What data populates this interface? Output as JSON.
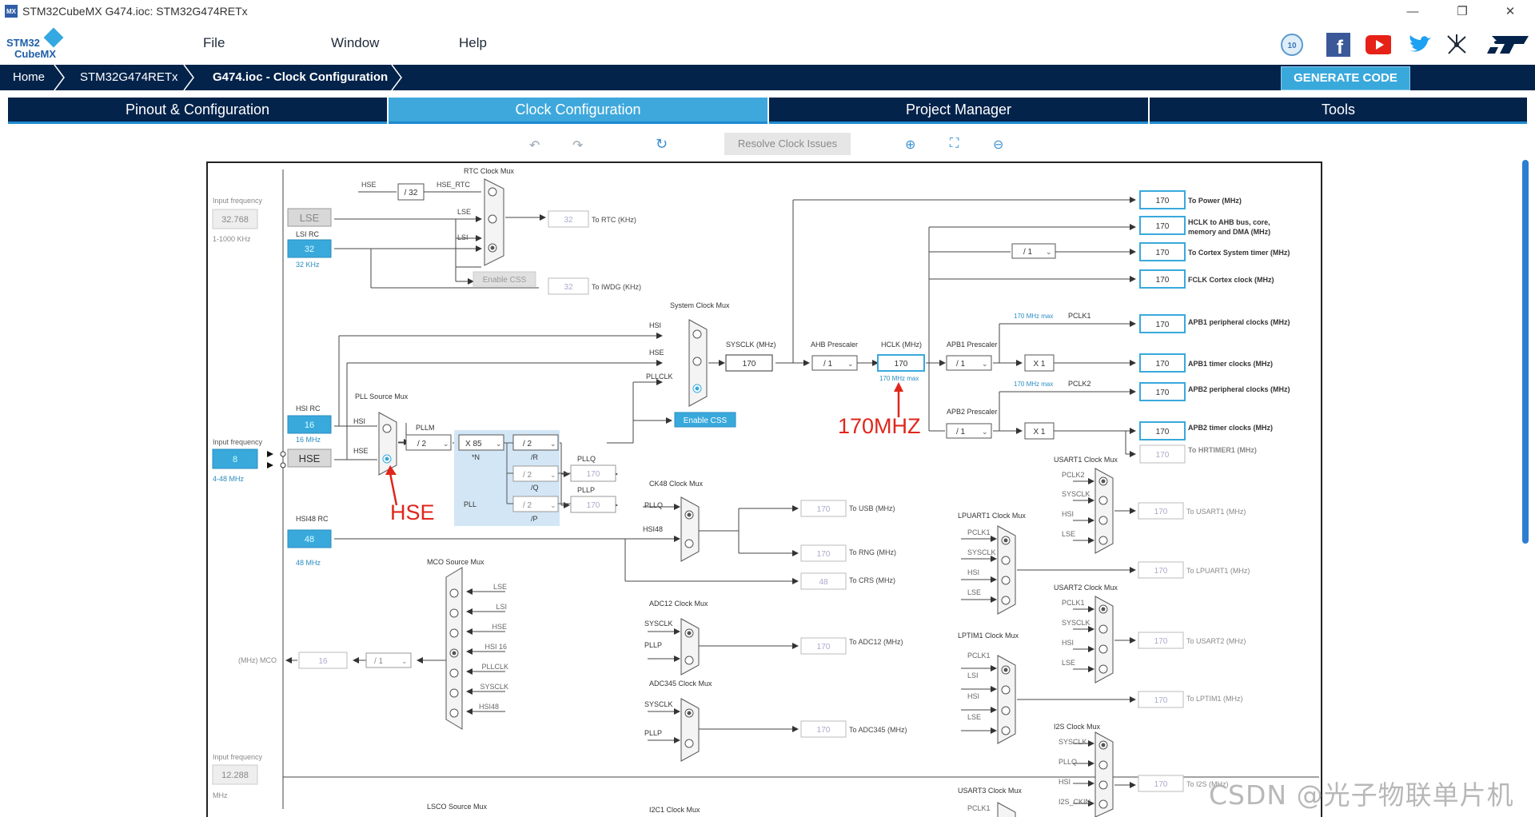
{
  "window": {
    "title": "STM32CubeMX G474.ioc: STM32G474RETx",
    "minimize": "—",
    "restore": "❐",
    "close": "✕"
  },
  "app": {
    "logo_line1": "STM32",
    "logo_line2": "CubeMX",
    "icon_text": "MX"
  },
  "menu": {
    "items": [
      "File",
      "Window",
      "Help"
    ]
  },
  "breadcrumb": [
    "Home",
    "STM32G474RETx",
    "G474.ioc - Clock Configuration"
  ],
  "generate_code_label": "GENERATE CODE",
  "tabs": [
    "Pinout & Configuration",
    "Clock Configuration",
    "Project Manager",
    "Tools"
  ],
  "active_tab": "Clock Configuration",
  "toolbar": {
    "resolve_label": "Resolve Clock Issues"
  },
  "colors": {
    "accent": "#3ea8dc",
    "navy": "#03234b",
    "red": "#e0261b"
  },
  "watermark": "CSDN @光子物联单片机",
  "diagram": {
    "inputs": {
      "lse_input_label": "Input frequency",
      "lse_input_value": "32.768",
      "lse_input_range": "1-1000 KHz",
      "hse_input_label": "Input frequency",
      "hse_input_value": "8",
      "hse_input_range": "4-48 MHz",
      "i2s_input_label": "Input frequency",
      "i2s_input_value": "12.288",
      "i2s_input_unit": "MHz"
    },
    "sources": {
      "lse": "LSE",
      "lsi_rc": "LSI RC",
      "lsi_value": "32",
      "lsi_unit": "32 KHz",
      "hsi_rc": "HSI RC",
      "hsi_value": "16",
      "hsi_unit": "16 MHz",
      "hse": "HSE",
      "hsi48_rc": "HSI48 RC",
      "hsi48_value": "48",
      "hsi48_unit": "48 MHz"
    },
    "rtc": {
      "title": "RTC Clock Mux",
      "hse": "HSE",
      "div": "/ 32",
      "hse_rtc": "HSE_RTC",
      "lse": "LSE",
      "lsi": "LSI",
      "enable_css": "Enable CSS",
      "rtc_value": "32",
      "rtc_label": "To RTC (KHz)",
      "iwdg_value": "32",
      "iwdg_label": "To IWDG (KHz)"
    },
    "pll": {
      "source_mux": "PLL Source Mux",
      "hsi": "HSI",
      "hse": "HSE",
      "pllm_label": "PLLM",
      "pllm": "/ 2",
      "muln": "X 85",
      "n": "*N",
      "divr": "/ 2",
      "r": "/R",
      "divq": "/ 2",
      "q": "/Q",
      "divp": "/ 2",
      "p": "/P",
      "pll": "PLL",
      "pllq": "PLLQ",
      "pllq_value": "170",
      "pllp": "PLLP",
      "pllp_value": "170"
    },
    "sysmux": {
      "title": "System Clock Mux",
      "hsi": "HSI",
      "hse": "HSE",
      "pllclk": "PLLCLK",
      "enable_css": "Enable CSS",
      "sysclk_label": "SYSCLK (MHz)",
      "sysclk": "170"
    },
    "ahb": {
      "label": "AHB Prescaler",
      "value": "/ 1",
      "hclk_label": "HCLK (MHz)",
      "hclk": "170",
      "hclk_max": "170 MHz max"
    },
    "apb1": {
      "label": "APB1 Prescaler",
      "value": "/ 1",
      "x": "X 1",
      "max": "170 MHz max",
      "pclk": "PCLK1"
    },
    "apb2": {
      "label": "APB2 Prescaler",
      "value": "/ 1",
      "x": "X 1",
      "max": "170 MHz max",
      "pclk": "PCLK2"
    },
    "cortex_div": "/ 1",
    "outputs": [
      {
        "value": "170",
        "label": "To Power (MHz)"
      },
      {
        "value": "170",
        "label": "HCLK to AHB bus, core,",
        "label2": "memory and DMA (MHz)"
      },
      {
        "value": "170",
        "label": "To Cortex System timer (MHz)"
      },
      {
        "value": "170",
        "label": "FCLK Cortex clock (MHz)"
      },
      {
        "value": "170",
        "label": "APB1 peripheral clocks (MHz)"
      },
      {
        "value": "170",
        "label": "APB1 timer clocks (MHz)"
      },
      {
        "value": "170",
        "label": "APB2 peripheral clocks (MHz)"
      },
      {
        "value": "170",
        "label": "APB2 timer clocks (MHz)"
      },
      {
        "value": "170",
        "label": "To HRTIMER1 (MHz)"
      }
    ],
    "ck48": {
      "title": "CK48 Clock Mux",
      "pllq": "PLLQ",
      "hsi48": "HSI48",
      "usb": "170",
      "usb_label": "To USB (MHz)",
      "rng": "170",
      "rng_label": "To RNG (MHz)",
      "crs": "48",
      "crs_label": "To CRS (MHz)"
    },
    "mco": {
      "title": "MCO Source Mux",
      "inputs": [
        "LSE",
        "LSI",
        "HSE",
        "HSI 16",
        "PLLCLK",
        "SYSCLK",
        "HSI48"
      ],
      "label": "(MHz) MCO",
      "value": "16",
      "div": "/ 1"
    },
    "adc12": {
      "title": "ADC12 Clock Mux",
      "sysclk": "SYSCLK",
      "pllp": "PLLP",
      "value": "170",
      "label": "To ADC12 (MHz)"
    },
    "adc345": {
      "title": "ADC345 Clock Mux",
      "sysclk": "SYSCLK",
      "pllp": "PLLP",
      "value": "170",
      "label": "To ADC345 (MHz)"
    },
    "usart1": {
      "title": "USART1 Clock Mux",
      "inputs": [
        "PCLK2",
        "SYSCLK",
        "HSI",
        "LSE"
      ],
      "value": "170",
      "label": "To USART1 (MHz)"
    },
    "lpuart1": {
      "title": "LPUART1 Clock Mux",
      "inputs": [
        "PCLK1",
        "SYSCLK",
        "HSI",
        "LSE"
      ],
      "value": "170",
      "label": "To LPUART1 (MHz)"
    },
    "usart2": {
      "title": "USART2 Clock Mux",
      "inputs": [
        "PCLK1",
        "SYSCLK",
        "HSI",
        "LSE"
      ],
      "value": "170",
      "label": "To USART2 (MHz)"
    },
    "lptim1": {
      "title": "LPTIM1 Clock Mux",
      "inputs": [
        "PCLK1",
        "LSI",
        "HSI",
        "LSE"
      ],
      "value": "170",
      "label": "To LPTIM1 (MHz)"
    },
    "i2s": {
      "title": "I2S Clock Mux",
      "inputs": [
        "SYSCLK",
        "PLLQ",
        "HSI",
        "I2S_CKIN"
      ],
      "value": "170",
      "label": "To I2S (MHz)"
    },
    "usart3": {
      "title": "USART3 Clock Mux",
      "inputs": [
        "PCLK1"
      ]
    },
    "lsco": {
      "title": "LSCO Source Mux"
    },
    "i2c1": {
      "title": "I2C1 Clock Mux"
    },
    "annotations": {
      "hse": "HSE",
      "hclk": "170MHZ"
    }
  }
}
